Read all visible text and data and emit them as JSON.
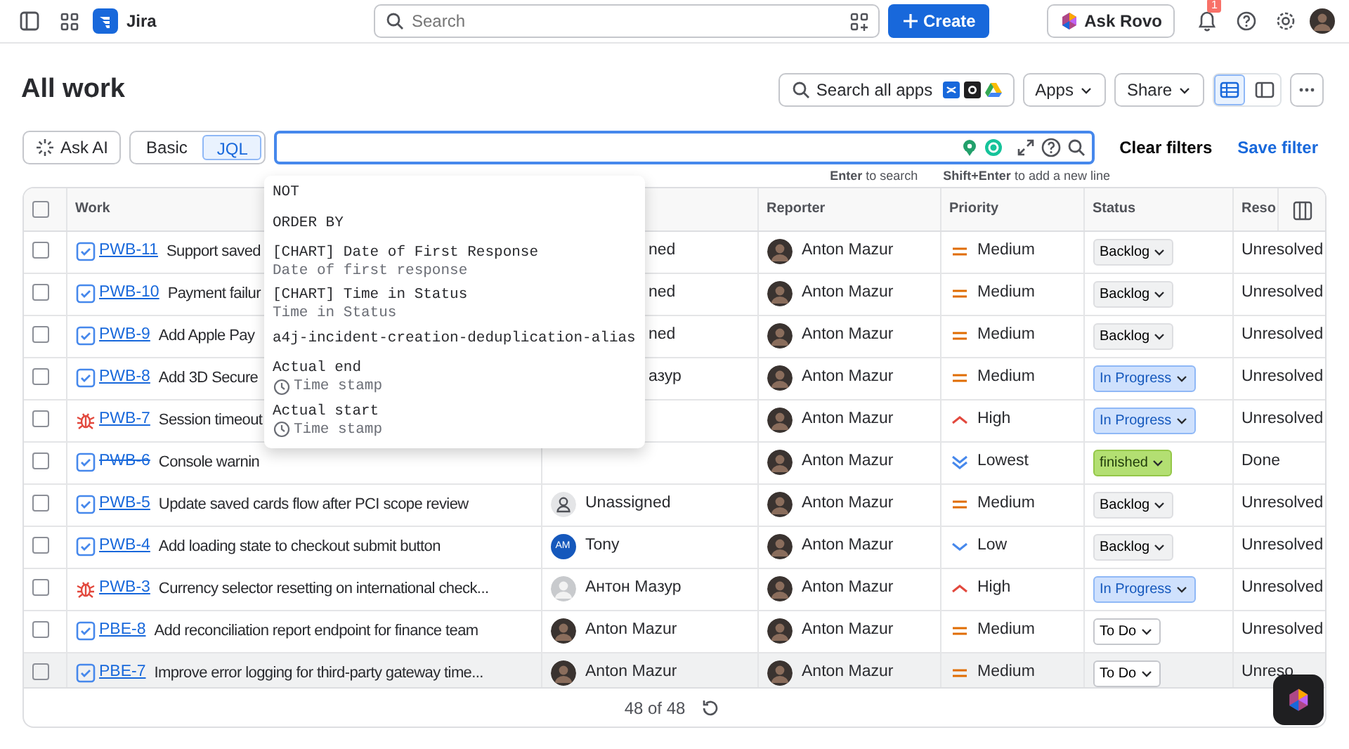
{
  "topbar": {
    "app_name": "Jira",
    "search_placeholder": "Search",
    "create_label": "Create",
    "ask_rovo_label": "Ask Rovo",
    "notification_count": "1"
  },
  "page": {
    "title": "All work",
    "search_apps_label": "Search all apps",
    "apps_label": "Apps",
    "share_label": "Share",
    "view_modes": [
      {
        "kind": "list",
        "selected": true
      },
      {
        "kind": "detail",
        "selected": false
      }
    ]
  },
  "filter": {
    "ask_ai_label": "Ask AI",
    "modes": [
      {
        "label": "Basic",
        "selected": false
      },
      {
        "label": "JQL",
        "selected": true
      }
    ],
    "clear_label": "Clear filters",
    "save_label": "Save filter",
    "hints": [
      {
        "key": "Enter",
        "text": "to search"
      },
      {
        "key": "Shift+Enter",
        "text": "to add a new line"
      }
    ]
  },
  "suggestions": [
    {
      "kind": "keyword",
      "label": "NOT"
    },
    {
      "kind": "keyword",
      "label": "ORDER BY"
    },
    {
      "kind": "field",
      "label": "[CHART] Date of First Response",
      "detail": "Date of first response"
    },
    {
      "kind": "field",
      "label": "[CHART] Time in Status",
      "detail": "Time in Status"
    },
    {
      "kind": "keyword",
      "label": "a4j-incident-creation-deduplication-alias"
    },
    {
      "kind": "datetime",
      "label": "Actual end",
      "detail": "Time stamp"
    },
    {
      "kind": "datetime",
      "label": "Actual start",
      "detail": "Time stamp"
    }
  ],
  "table": {
    "all_checked": false,
    "columns": [
      {
        "label": "Work"
      },
      {},
      {
        "label": "Reporter"
      },
      {
        "label": "Priority"
      },
      {
        "label": "Status"
      },
      {
        "label": "Reso"
      }
    ],
    "rows": [
      {
        "kind": "task",
        "checked": false,
        "key": "PWB-11",
        "done": false,
        "hovered": false,
        "summary": "Support saved",
        "assignee": {
          "name": "ned"
        },
        "reporter": {
          "name": "Anton Mazur",
          "kind": "photo"
        },
        "priority": "Medium",
        "status": {
          "kind": "backlog",
          "label": "Backlog"
        },
        "resolution": "Unresolved"
      },
      {
        "kind": "task",
        "checked": false,
        "key": "PWB-10",
        "done": false,
        "hovered": false,
        "summary": "Payment failur",
        "assignee": {
          "name": "ned"
        },
        "reporter": {
          "name": "Anton Mazur",
          "kind": "photo"
        },
        "priority": "Medium",
        "status": {
          "kind": "backlog",
          "label": "Backlog"
        },
        "resolution": "Unresolved"
      },
      {
        "kind": "task",
        "checked": false,
        "key": "PWB-9",
        "done": false,
        "hovered": false,
        "summary": "Add Apple Pay",
        "assignee": {
          "name": "ned"
        },
        "reporter": {
          "name": "Anton Mazur",
          "kind": "photo"
        },
        "priority": "Medium",
        "status": {
          "kind": "backlog",
          "label": "Backlog"
        },
        "resolution": "Unresolved"
      },
      {
        "kind": "task",
        "checked": false,
        "key": "PWB-8",
        "done": false,
        "hovered": false,
        "summary": "Add 3D Secure",
        "assignee": {
          "name": "азур"
        },
        "reporter": {
          "name": "Anton Mazur",
          "kind": "photo"
        },
        "priority": "Medium",
        "status": {
          "kind": "inprogress",
          "label": "In Progress"
        },
        "resolution": "Unresolved"
      },
      {
        "kind": "bug",
        "checked": false,
        "key": "PWB-7",
        "done": false,
        "hovered": false,
        "summary": "Session timeout",
        "reporter": {
          "name": "Anton Mazur",
          "kind": "photo"
        },
        "priority": "High",
        "status": {
          "kind": "inprogress",
          "label": "In Progress"
        },
        "resolution": "Unresolved"
      },
      {
        "kind": "task",
        "checked": false,
        "key": "PWB-6",
        "done": true,
        "hovered": false,
        "summary": "Console warnin",
        "reporter": {
          "name": "Anton Mazur",
          "kind": "photo"
        },
        "priority": "Lowest",
        "status": {
          "kind": "done",
          "label": "finished"
        },
        "resolution": "Done"
      },
      {
        "kind": "task",
        "checked": false,
        "key": "PWB-5",
        "done": false,
        "hovered": false,
        "summary": "Update saved cards flow after PCI scope review",
        "assignee": {
          "name": "Unassigned",
          "kind": "unassigned"
        },
        "reporter": {
          "name": "Anton Mazur",
          "kind": "photo"
        },
        "priority": "Medium",
        "status": {
          "kind": "backlog",
          "label": "Backlog"
        },
        "resolution": "Unresolved"
      },
      {
        "kind": "task",
        "checked": false,
        "key": "PWB-4",
        "done": false,
        "hovered": false,
        "summary": "Add loading state to checkout submit button",
        "assignee": {
          "name": "Tony",
          "kind": "initials",
          "initials": "AM"
        },
        "reporter": {
          "name": "Anton Mazur",
          "kind": "photo"
        },
        "priority": "Low",
        "status": {
          "kind": "backlog",
          "label": "Backlog"
        },
        "resolution": "Unresolved"
      },
      {
        "kind": "bug",
        "checked": false,
        "key": "PWB-3",
        "done": false,
        "hovered": false,
        "summary": "Currency selector resetting on international check...",
        "assignee": {
          "name": "Антон Мазур",
          "kind": "photo-light"
        },
        "reporter": {
          "name": "Anton Mazur",
          "kind": "photo"
        },
        "priority": "High",
        "status": {
          "kind": "inprogress",
          "label": "In Progress"
        },
        "resolution": "Unresolved"
      },
      {
        "kind": "task",
        "checked": false,
        "key": "PBE-8",
        "done": false,
        "hovered": false,
        "summary": "Add reconciliation report endpoint for finance team",
        "assignee": {
          "name": "Anton Mazur",
          "kind": "photo"
        },
        "reporter": {
          "name": "Anton Mazur",
          "kind": "photo"
        },
        "priority": "Medium",
        "status": {
          "kind": "todo",
          "label": "To Do"
        },
        "resolution": "Unresolved"
      },
      {
        "kind": "task",
        "checked": false,
        "key": "PBE-7",
        "done": false,
        "hovered": true,
        "summary": "Improve error logging for third-party gateway time...",
        "assignee": {
          "name": "Anton Mazur",
          "kind": "photo"
        },
        "reporter": {
          "name": "Anton Mazur",
          "kind": "photo"
        },
        "priority": "Medium",
        "status": {
          "kind": "todo",
          "label": "To Do"
        },
        "resolution": "Unreso"
      }
    ],
    "count": "48 of 48"
  }
}
